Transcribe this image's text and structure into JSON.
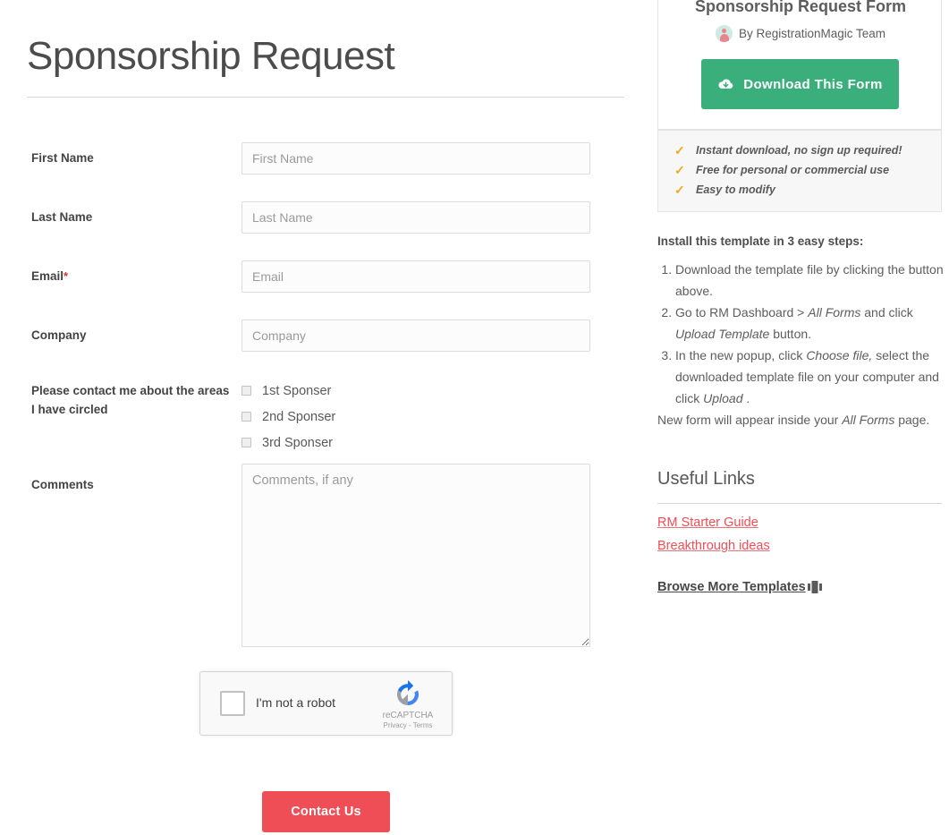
{
  "page": {
    "title": "Sponsorship Request"
  },
  "form": {
    "fields": [
      {
        "label": "First Name",
        "required": false,
        "placeholder": "First Name",
        "value": "",
        "type": "text"
      },
      {
        "label": "Last Name",
        "required": false,
        "placeholder": "Last Name",
        "value": "",
        "type": "text"
      },
      {
        "label": "Email",
        "required": true,
        "required_mark": "*",
        "placeholder": "Email",
        "value": "",
        "type": "text"
      },
      {
        "label": "Company",
        "required": false,
        "placeholder": "Company",
        "value": "",
        "type": "text"
      }
    ],
    "checkbox_group": {
      "label": "Please contact me about the areas I have circled",
      "options": [
        {
          "label": "1st Sponser",
          "checked": false
        },
        {
          "label": "2nd Sponser",
          "checked": false
        },
        {
          "label": "3rd Sponser",
          "checked": false
        }
      ]
    },
    "comments": {
      "label": "Comments",
      "placeholder": "Comments, if any",
      "value": ""
    },
    "recaptcha": {
      "label": "I'm not a robot",
      "brand": "reCAPTCHA",
      "legal": "Privacy - Terms",
      "checked": false
    },
    "submit_label": "Contact Us"
  },
  "sidebar": {
    "template_card": {
      "title": "Sponsorship Request Form",
      "author_prefix": "By",
      "author": "By RegistrationMagic Team",
      "download_label": "Download This Form"
    },
    "features": [
      "Instant download, no sign up required!",
      "Free for personal or commercial use",
      "Easy to modify"
    ],
    "install": {
      "heading": "Install this template in 3 easy steps:",
      "step1": "Download the template file by clicking the button above.",
      "step2_a": "Go to RM Dashboard > ",
      "step2_em1": "All Forms",
      "step2_b": " and click ",
      "step2_em2": "Upload Template",
      "step2_c": " button.",
      "step3_a": "In the new popup, click ",
      "step3_em1": "Choose file,",
      "step3_b": " select the downloaded template file on your computer and click ",
      "step3_em2": "Upload",
      "step3_c": " .",
      "footer_a": "New form will appear inside your ",
      "footer_em": "All Forms",
      "footer_b": " page."
    },
    "links": {
      "heading": "Useful Links",
      "items": [
        "RM Starter Guide",
        "Breakthrough ideas"
      ],
      "browse_more": "Browse More Templates"
    }
  },
  "colors": {
    "accent_red": "#ef4e56",
    "accent_green": "#3aaf7b",
    "check_orange": "#f5a623",
    "required_star": "#e03131"
  }
}
